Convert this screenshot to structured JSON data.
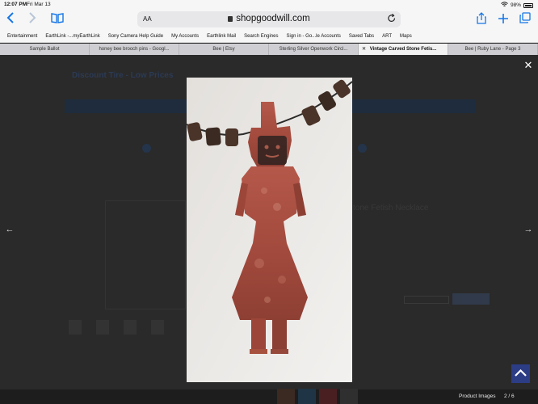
{
  "status": {
    "time": "12:07 PM",
    "date": "Fri Mar 13",
    "battery": "98%"
  },
  "toolbar": {
    "text_size": "AA",
    "domain": "shopgoodwill.com"
  },
  "bookmarks": [
    "Entertainment",
    "EarthLink -...myEarthLink",
    "Sony Camera Help Guide",
    "My Accounts",
    "Earthlink Mail",
    "Search Engines",
    "Sign in - Go...le Accounts",
    "Saved Tabs",
    "ART",
    "Maps"
  ],
  "tabs": [
    {
      "label": "Sample Ballot",
      "active": false
    },
    {
      "label": "honey bee brooch pins - Googl...",
      "active": false
    },
    {
      "label": "Bee | Etsy",
      "active": false
    },
    {
      "label": "Sterling Silver Openwork Circl...",
      "active": false
    },
    {
      "label": "Vintage Carved Stone Fetis...",
      "active": true
    },
    {
      "label": "Bee | Ruby Lane - Page 3",
      "active": false
    }
  ],
  "background_page": {
    "logo": "Discount Tire - Low Prices",
    "product_title_fragment": "tone Fetish Necklace"
  },
  "lightbox": {
    "caption": "Product Images",
    "counter": "2 / 6",
    "close_icon": "close-icon",
    "prev_icon": "chevron-left-icon",
    "next_icon": "chevron-right-icon"
  },
  "colors": {
    "accent": "#1677e6",
    "overlay": "#2a2a2a",
    "scroll_top_button": "#2c3d86"
  }
}
